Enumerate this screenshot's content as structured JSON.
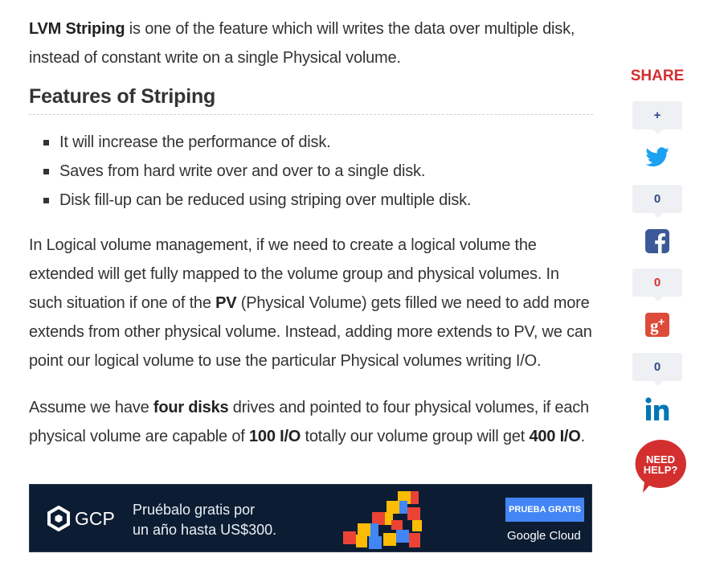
{
  "article": {
    "para1_strong": "LVM Striping",
    "para1_rest": " is one of the feature which will writes the data over multiple disk, instead of constant write on a single Physical volume.",
    "heading": "Features of Striping",
    "bullets": [
      "It will increase the performance of disk.",
      "Saves from hard write over and over to a single disk.",
      "Disk fill-up can be reduced using striping over multiple disk."
    ],
    "para2_a": "In Logical volume management, if we need to create a logical volume the extended will get fully mapped to the volume group and physical volumes. In such situation if one of the ",
    "para2_pv": "PV",
    "para2_b": " (Physical Volume) gets filled we need to add more extends from other physical volume. Instead, adding more extends to PV, we can point our logical volume to use the particular Physical volumes writing I/O.",
    "para3_a": "Assume we have ",
    "para3_strong1": "four disks",
    "para3_b": " drives and pointed to four physical volumes, if each physical volume are capable of ",
    "para3_strong2": "100 I/O",
    "para3_c": " totally our volume group will get ",
    "para3_strong3": "400 I/O",
    "para3_d": "."
  },
  "ad": {
    "brand": "GCP",
    "line1": "Pruébalo gratis por",
    "line2": "un año hasta US$300.",
    "button": "PRUEBA GRATIS",
    "footer": "Google Cloud"
  },
  "share": {
    "title": "SHARE",
    "plus": "+",
    "facebook_count": "0",
    "google_count": "0",
    "linkedin_count": "0",
    "help_line1": "NEED",
    "help_line2": "HELP?",
    "colors": {
      "twitter": "#1da1f2",
      "facebook": "#3b5998",
      "google": "#dd4b39",
      "linkedin": "#0077b5",
      "help": "#d32f2f"
    },
    "icons": [
      "plus-icon",
      "twitter-icon",
      "facebook-icon",
      "google-plus-icon",
      "linkedin-icon",
      "need-help-icon"
    ]
  }
}
